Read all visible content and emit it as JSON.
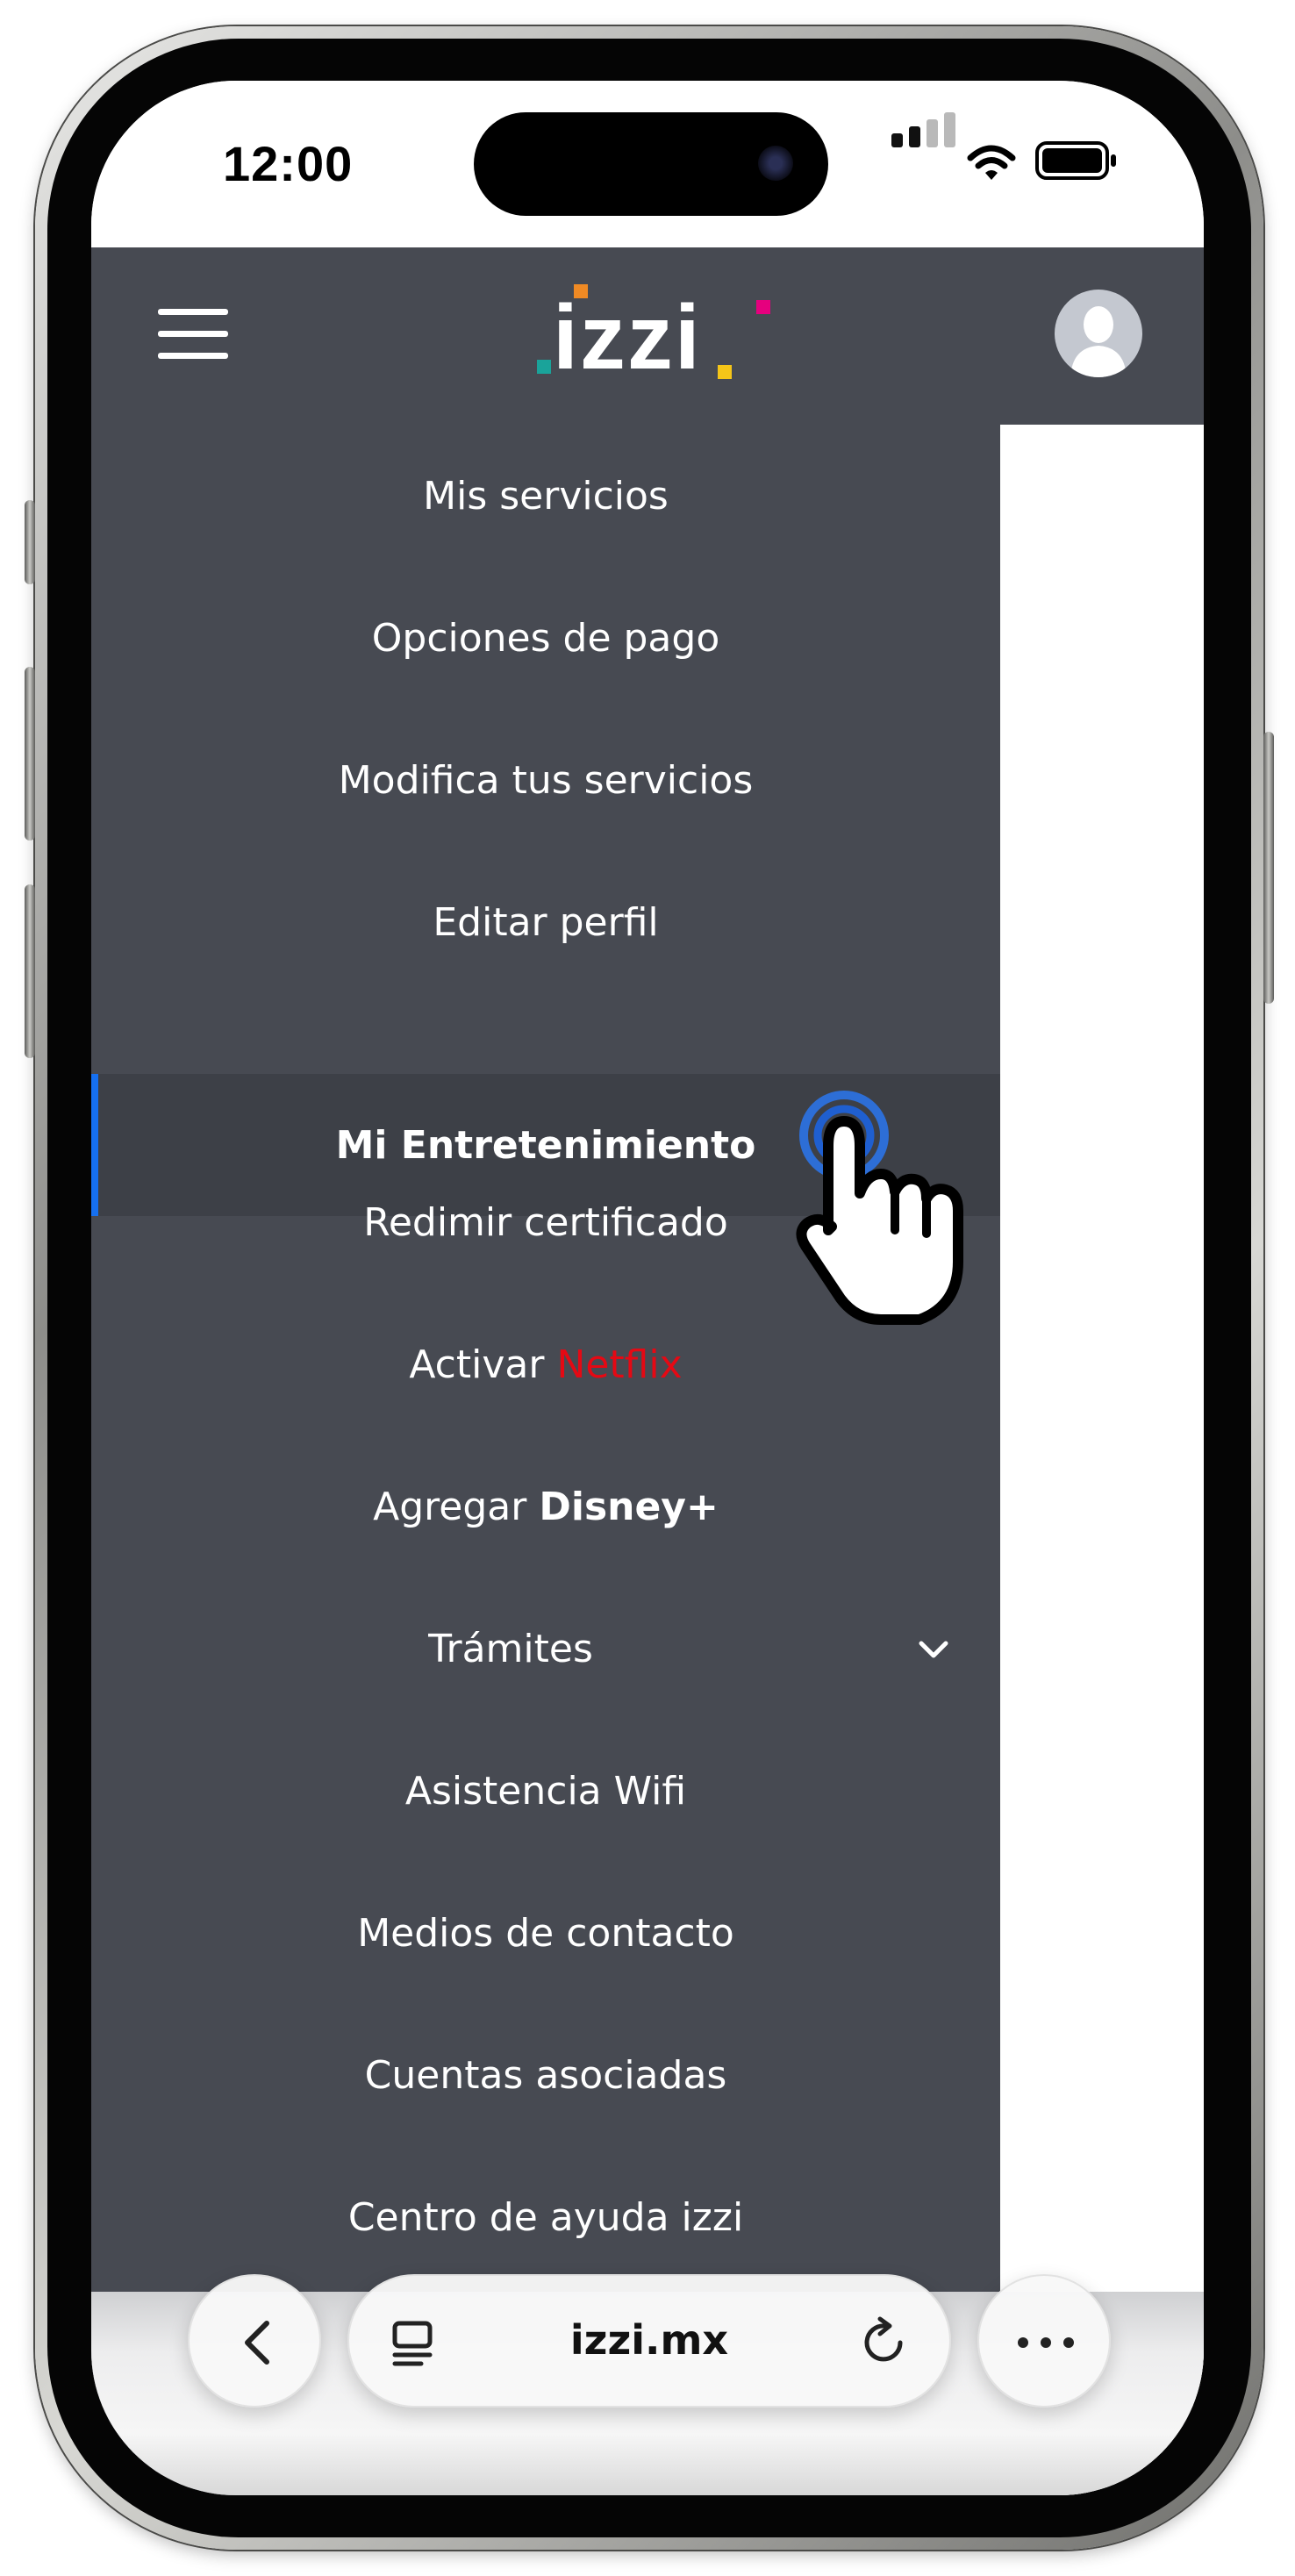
{
  "status_bar": {
    "time": "12:00"
  },
  "app": {
    "logo_text": "izzi",
    "logo_colors": [
      "#1aa39a",
      "#f08a24",
      "#f5c518",
      "#e6007e"
    ]
  },
  "menu": {
    "items": [
      {
        "label": "Mis servicios"
      },
      {
        "label": "Opciones de pago"
      },
      {
        "label": "Modifica tus servicios"
      },
      {
        "label": "Editar perfil"
      },
      {
        "label": "Mi Entretenimiento",
        "active": true
      },
      {
        "label": "Redimir certificado"
      },
      {
        "label": "Activar",
        "brand": "Netflix"
      },
      {
        "label": "Agregar",
        "brand": "Disney+"
      },
      {
        "label": "Trámites",
        "expandable": true
      },
      {
        "label": "Asistencia Wifi"
      },
      {
        "label": "Medios de contacto"
      },
      {
        "label": "Cuentas asociadas"
      },
      {
        "label": "Centro de ayuda izzi"
      }
    ]
  },
  "browser": {
    "url": "izzi.mx"
  },
  "colors": {
    "menu_bg": "#474a52",
    "active_bg": "#3d4047",
    "active_indicator": "#1670f0",
    "netflix_red": "#e50914"
  }
}
